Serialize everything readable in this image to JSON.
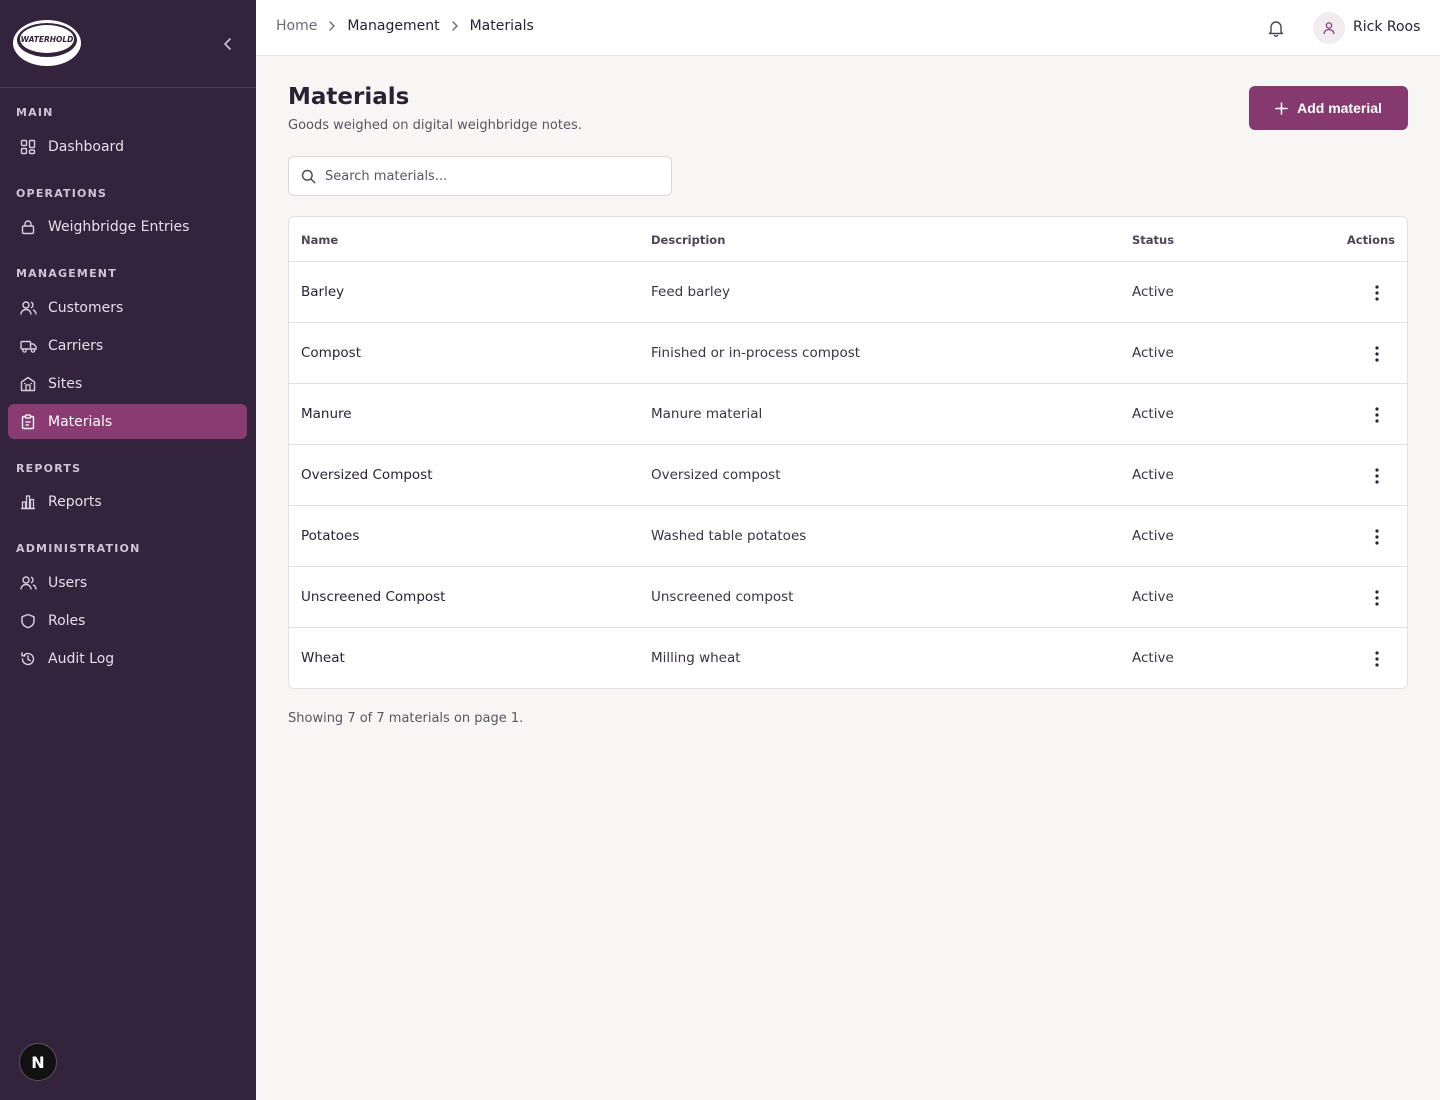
{
  "brand": {
    "logo_text": "WATERHOLD"
  },
  "sidebar": {
    "sections": {
      "main": "MAIN",
      "operations": "OPERATIONS",
      "management": "MANAGEMENT",
      "reports": "REPORTS",
      "administration": "ADMINISTRATION"
    },
    "items": {
      "dashboard": "Dashboard",
      "weighbridge": "Weighbridge Entries",
      "customers": "Customers",
      "carriers": "Carriers",
      "sites": "Sites",
      "materials": "Materials",
      "reports": "Reports",
      "users": "Users",
      "roles": "Roles",
      "audit_log": "Audit Log"
    },
    "active_item": "materials",
    "badge_letter": "N"
  },
  "breadcrumb": [
    "Home",
    "Management",
    "Materials"
  ],
  "user": {
    "name": "Rick Roos"
  },
  "page": {
    "title": "Materials",
    "subtitle": "Goods weighed on digital weighbridge notes.",
    "add_button": "Add material",
    "search_placeholder": "Search materials..."
  },
  "table": {
    "headers": {
      "name": "Name",
      "description": "Description",
      "status": "Status",
      "actions": "Actions"
    },
    "rows": [
      {
        "name": "Barley",
        "description": "Feed barley",
        "status": "Active"
      },
      {
        "name": "Compost",
        "description": "Finished or in-process compost",
        "status": "Active"
      },
      {
        "name": "Manure",
        "description": "Manure material",
        "status": "Active"
      },
      {
        "name": "Oversized Compost",
        "description": "Oversized compost",
        "status": "Active"
      },
      {
        "name": "Potatoes",
        "description": "Washed table potatoes",
        "status": "Active"
      },
      {
        "name": "Unscreened Compost",
        "description": "Unscreened compost",
        "status": "Active"
      },
      {
        "name": "Wheat",
        "description": "Milling wheat",
        "status": "Active"
      }
    ]
  },
  "footer": {
    "summary": "Showing 7 of 7 materials on page 1."
  },
  "colors": {
    "sidebar_bg": "#33233d",
    "accent": "#86396f",
    "page_bg": "#f7f6f4"
  }
}
